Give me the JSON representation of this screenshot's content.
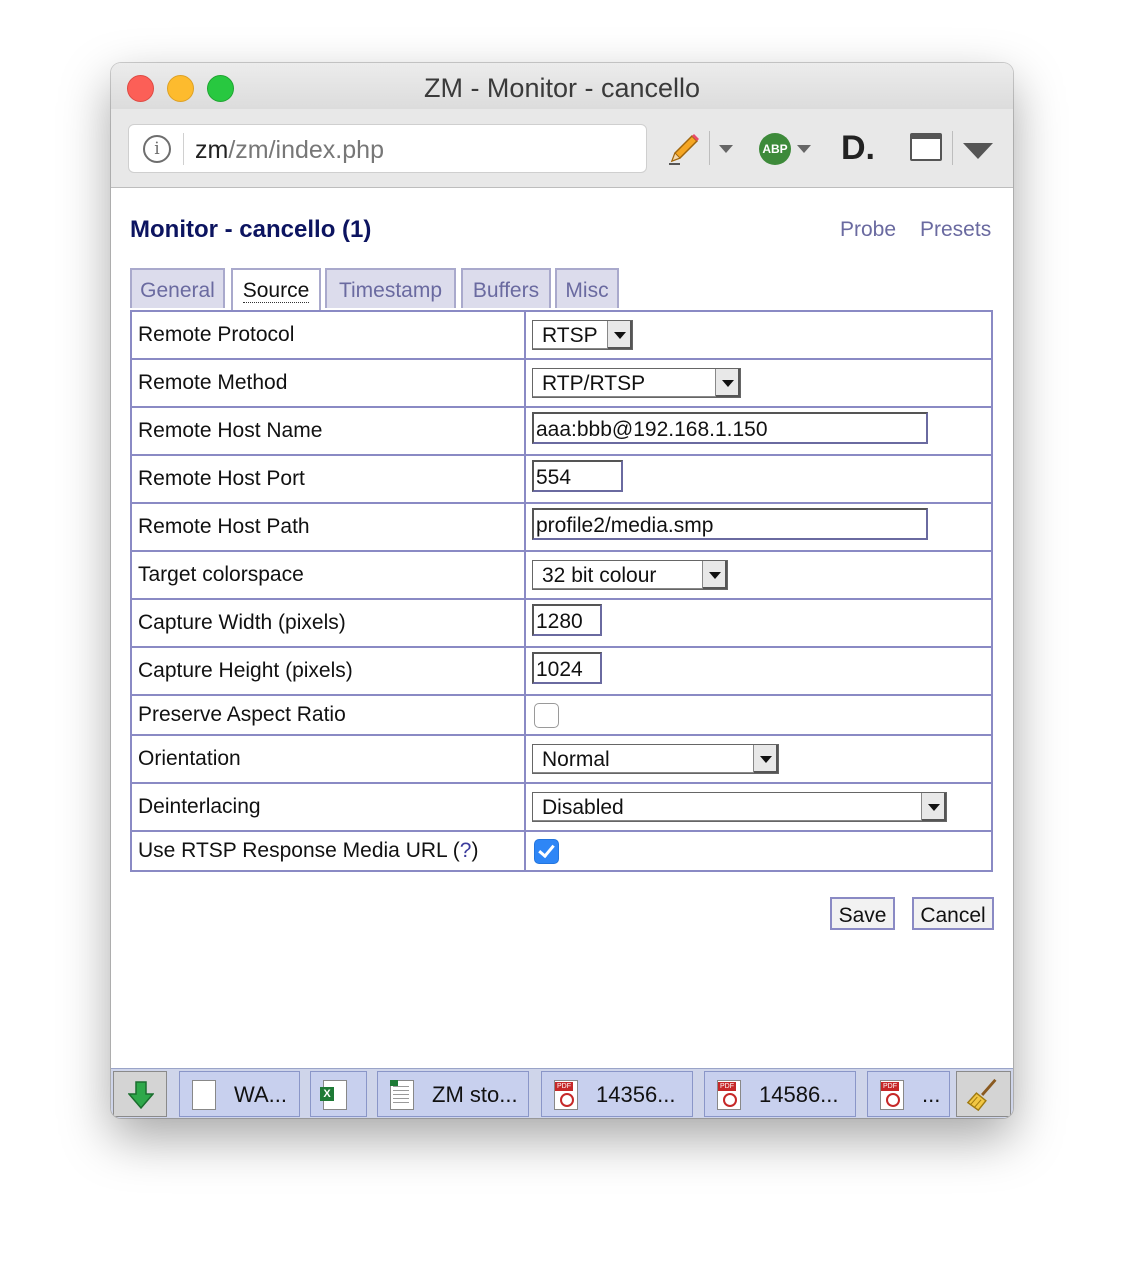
{
  "window": {
    "title": "ZM - Monitor - cancello"
  },
  "toolbar": {
    "url_host": "zm",
    "url_path": "/zm/index.php",
    "abp_label": "ABP",
    "d_label": "D."
  },
  "page": {
    "title": "Monitor - cancello (1)",
    "probe_label": "Probe",
    "presets_label": "Presets"
  },
  "tabs": [
    "General",
    "Source",
    "Timestamp",
    "Buffers",
    "Misc"
  ],
  "active_tab": "Source",
  "fields": {
    "remote_protocol": {
      "label": "Remote Protocol",
      "value": "RTSP"
    },
    "remote_method": {
      "label": "Remote Method",
      "value": "RTP/RTSP"
    },
    "remote_host_name": {
      "label": "Remote Host Name",
      "value": "aaa:bbb@192.168.1.150"
    },
    "remote_host_port": {
      "label": "Remote Host Port",
      "value": "554"
    },
    "remote_host_path": {
      "label": "Remote Host Path",
      "value": "profile2/media.smp"
    },
    "target_colorspace": {
      "label": "Target colorspace",
      "value": "32 bit colour"
    },
    "capture_width": {
      "label": "Capture Width (pixels)",
      "value": "1280"
    },
    "capture_height": {
      "label": "Capture Height (pixels)",
      "value": "1024"
    },
    "preserve_aspect": {
      "label": "Preserve Aspect Ratio",
      "checked": false
    },
    "orientation": {
      "label": "Orientation",
      "value": "Normal"
    },
    "deinterlacing": {
      "label": "Deinterlacing",
      "value": "Disabled"
    },
    "rtsp_media_url": {
      "label": "Use RTSP Response Media URL (",
      "label_end": ")",
      "help": "?",
      "checked": true
    }
  },
  "buttons": {
    "save": "Save",
    "cancel": "Cancel"
  },
  "taskbar": {
    "items": [
      {
        "label": "WA..."
      },
      {
        "label": ""
      },
      {
        "label": "ZM sto..."
      },
      {
        "label": "14356..."
      },
      {
        "label": "14586..."
      },
      {
        "label": "..."
      }
    ]
  },
  "colors": {
    "accent": "#0c1460",
    "link": "#6a6aa0",
    "border": "#8a8ac4",
    "checkbox_checked": "#2e86f6"
  }
}
